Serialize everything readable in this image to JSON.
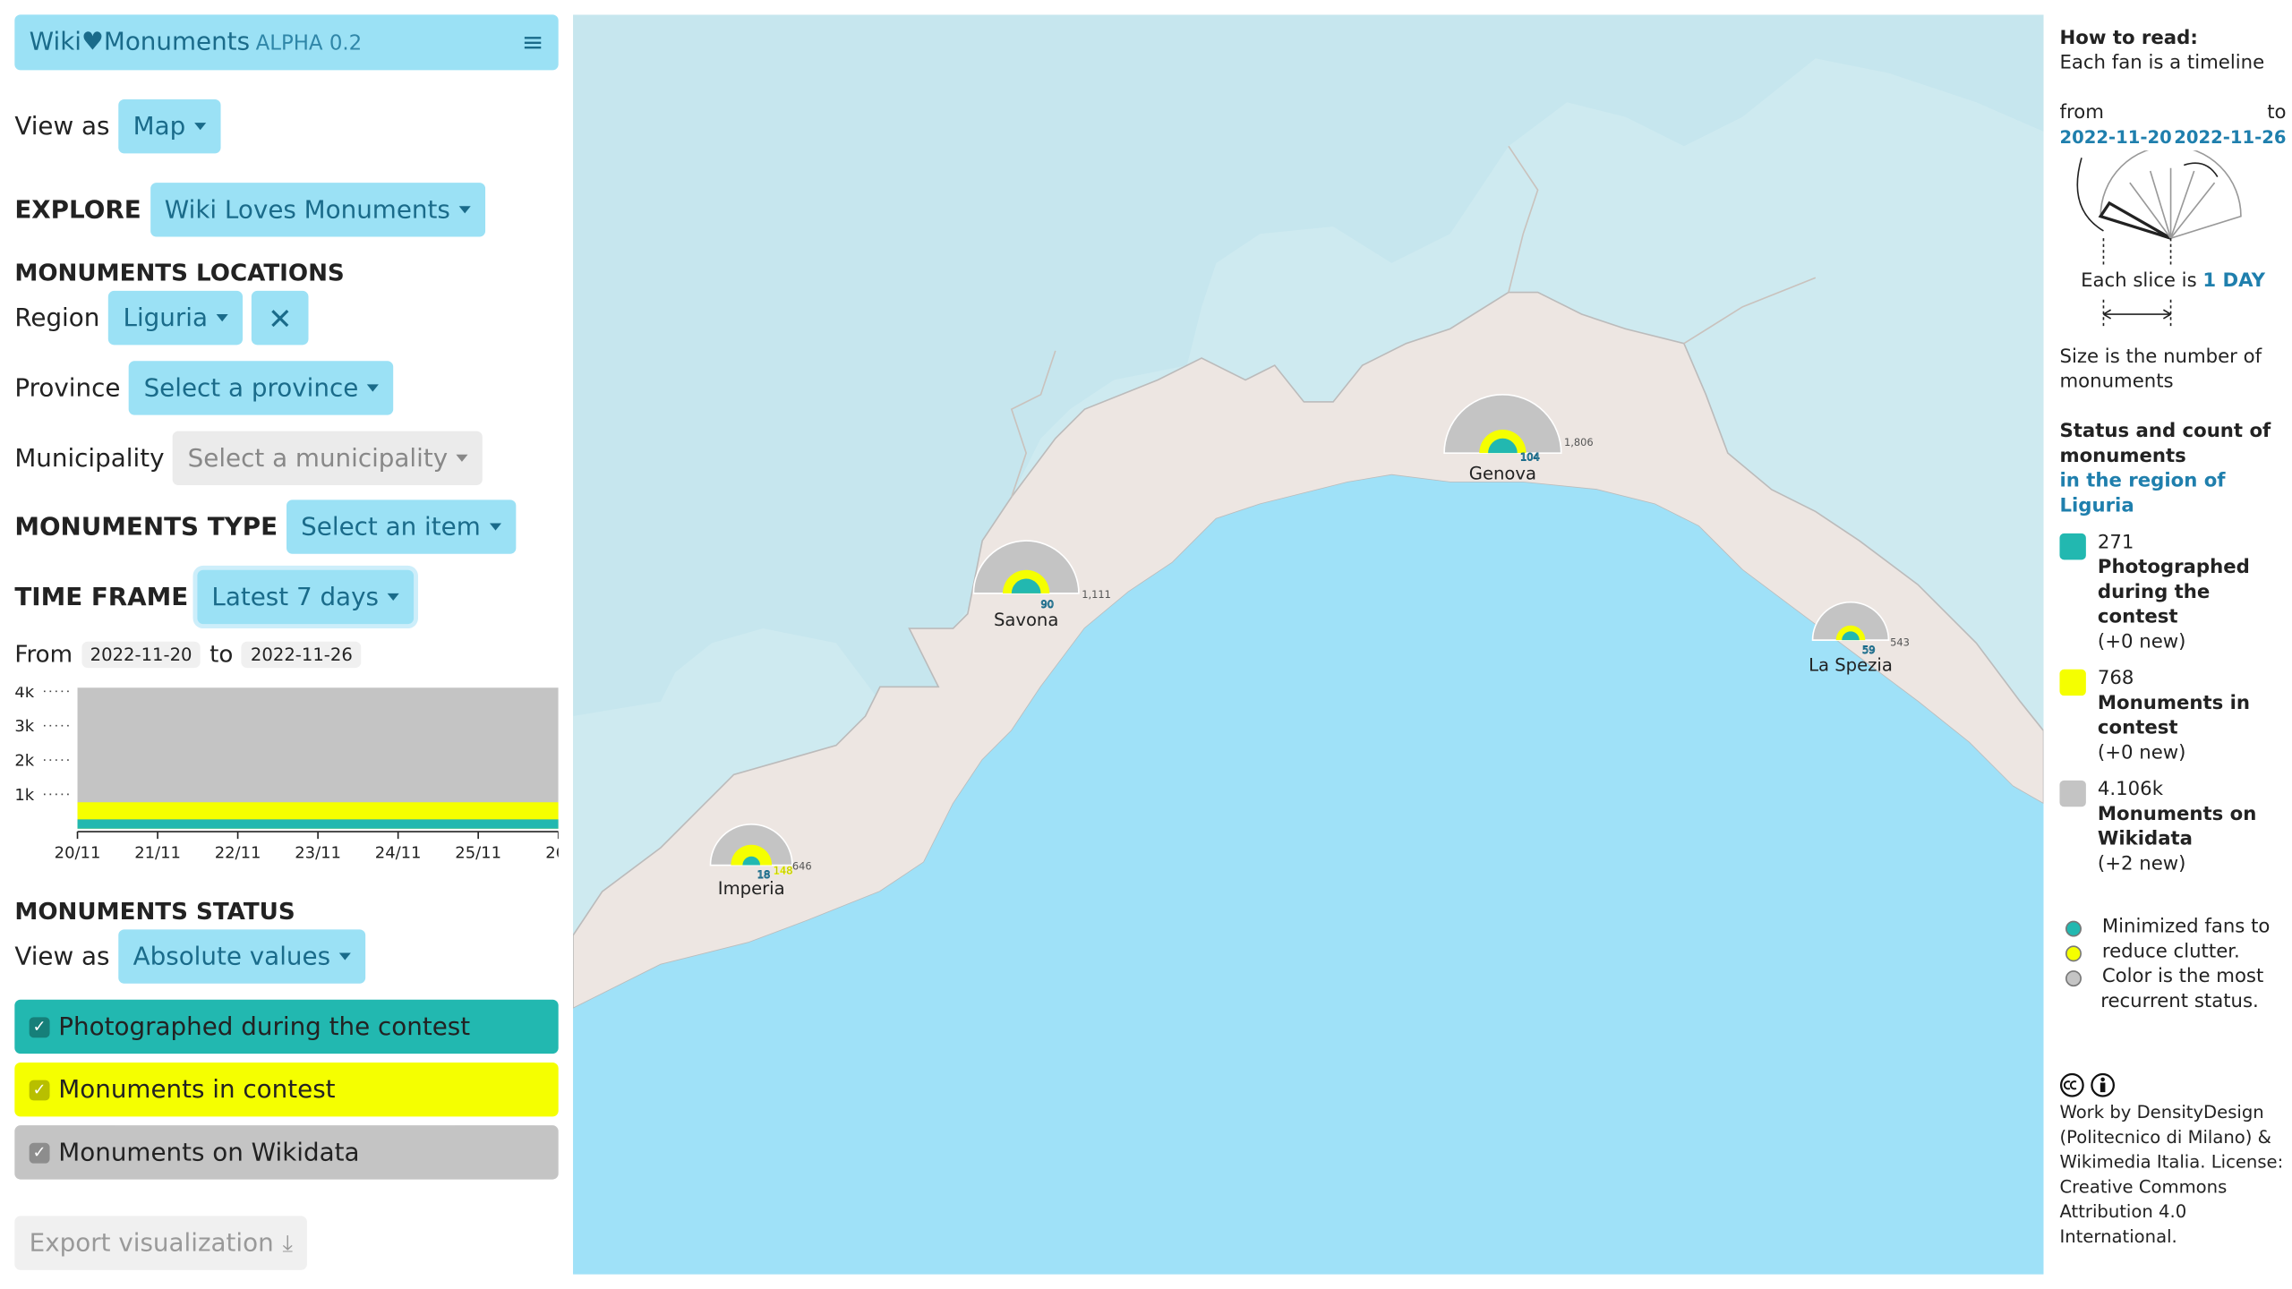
{
  "app": {
    "title": "Wiki♥Monuments",
    "version": "ALPHA 0.2"
  },
  "view_as": {
    "label": "View as",
    "value": "Map"
  },
  "explore": {
    "label": "EXPLORE",
    "value": "Wiki Loves Monuments"
  },
  "locations": {
    "heading": "MONUMENTS LOCATIONS",
    "region_label": "Region",
    "region_value": "Liguria",
    "province_label": "Province",
    "province_value": "Select a province",
    "municipality_label": "Municipality",
    "municipality_value": "Select a municipality"
  },
  "type": {
    "label": "MONUMENTS TYPE",
    "value": "Select an item"
  },
  "timeframe": {
    "label": "TIME FRAME",
    "value": "Latest 7 days",
    "from_label": "From",
    "from": "2022-11-20",
    "to_label": "to",
    "to": "2022-11-26"
  },
  "chart_data": {
    "type": "area",
    "x": [
      "20/11",
      "21/11",
      "22/11",
      "23/11",
      "24/11",
      "25/11",
      "26/"
    ],
    "y_ticks": [
      "4k",
      "3k",
      "2k",
      "1k"
    ],
    "ylim": [
      0,
      4000
    ],
    "series": [
      {
        "name": "Photographed during the contest",
        "color": "#22b8b0",
        "values": [
          271,
          271,
          271,
          271,
          271,
          271,
          271
        ]
      },
      {
        "name": "Monuments in contest",
        "color": "#f5ff00",
        "values": [
          768,
          768,
          768,
          768,
          768,
          768,
          768
        ]
      },
      {
        "name": "Monuments on Wikidata",
        "color": "#c4c4c4",
        "values": [
          4104,
          4104,
          4104,
          4104,
          4104,
          4104,
          4106
        ]
      }
    ]
  },
  "status": {
    "heading": "MONUMENTS STATUS",
    "view_label": "View as",
    "view_value": "Absolute values",
    "items": [
      {
        "label": "Photographed during the contest",
        "color": "#22b8b0"
      },
      {
        "label": "Monuments in contest",
        "color": "#f5ff00"
      },
      {
        "label": "Monuments on Wikidata",
        "color": "#c4c4c4"
      }
    ]
  },
  "export_label": "Export visualization",
  "map": {
    "cities": [
      {
        "name": "Genova",
        "photographed": "104",
        "total": "1,806"
      },
      {
        "name": "Savona",
        "photographed": "90",
        "total": "1,111"
      },
      {
        "name": "Imperia",
        "photographed": "18",
        "contest": "148",
        "total": "646"
      },
      {
        "name": "La Spezia",
        "photographed": "59",
        "total": "543"
      }
    ]
  },
  "legend": {
    "how_title": "How to read:",
    "how_sub": "Each fan is a timeline",
    "from_label": "from",
    "to_label": "to",
    "from_date": "2022-11-20",
    "to_date": "2022-11-26",
    "slice_text": "Each slice is",
    "slice_unit": "1 DAY",
    "size_text": "Size is the number of monuments",
    "status_title": "Status and count of monuments",
    "status_region": "in the region of Liguria",
    "items": [
      {
        "count": "271",
        "label": "Photographed during the contest",
        "delta": "(+0 new)",
        "color": "#22b8b0"
      },
      {
        "count": "768",
        "label": "Monuments in contest",
        "delta": "(+0 new)",
        "color": "#f5ff00"
      },
      {
        "count": "4.106k",
        "label": "Monuments on Wikidata",
        "delta": "(+2 new)",
        "color": "#c4c4c4"
      }
    ],
    "mini_lines": [
      "Minimized fans to",
      "reduce clutter.",
      "Color is the most",
      "recurrent status."
    ],
    "credits": "Work by DensityDesign (Politecnico di Milano) & Wikimedia Italia. License: Creative Commons Attribution 4.0 International."
  }
}
